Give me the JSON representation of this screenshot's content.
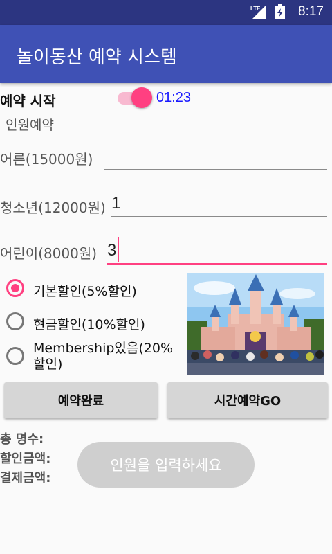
{
  "status_bar": {
    "network": "LTE",
    "time": "8:17"
  },
  "app": {
    "title": "놀이동산 예약 시스템"
  },
  "reservation": {
    "start_label": "예약 시작",
    "switch_on": true,
    "timer": "01:23"
  },
  "section": {
    "people_label": "인원예약"
  },
  "fields": {
    "adult": {
      "label": "어른(15000원)",
      "value": ""
    },
    "teen": {
      "label": "청소년(12000원)",
      "value": "1"
    },
    "child": {
      "label": "어린이(8000원)",
      "value": "3"
    }
  },
  "discounts": [
    {
      "label": "기본할인(5%할인)",
      "checked": true
    },
    {
      "label": "현금할인(10%할인)",
      "checked": false
    },
    {
      "label": "Membership있음(20%할인)",
      "checked": false
    }
  ],
  "image": {
    "icon": "castle-photo"
  },
  "buttons": {
    "complete": "예약완료",
    "time_go": "시간예약GO"
  },
  "summary": {
    "total_count_label": "총 명수:",
    "discount_label": "할인금액:",
    "payment_label": "결제금액:",
    "hint": "인원을 입력하세요"
  },
  "colors": {
    "primary": "#3f51b5",
    "primary_dark": "#2c3581",
    "accent": "#ff4081",
    "timer": "#1a1aff"
  }
}
